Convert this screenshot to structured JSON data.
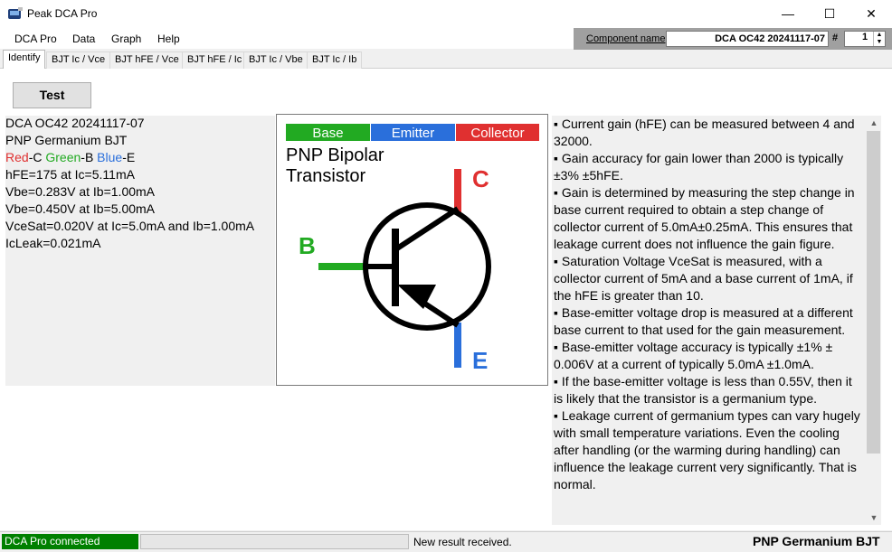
{
  "window": {
    "title": "Peak DCA Pro",
    "minimize": "—",
    "maximize": "☐",
    "close": "✕"
  },
  "menu": [
    "DCA Pro",
    "Data",
    "Graph",
    "Help"
  ],
  "component": {
    "label": "Component name",
    "value": "DCA OC42 20241117-07",
    "number_label": "#",
    "number_value": "1"
  },
  "tabs": [
    "Identify",
    "BJT Ic / Vce",
    "BJT hFE / Vce",
    "BJT hFE / Ic",
    "BJT Ic / Vbe",
    "BJT Ic / Ib"
  ],
  "test_button": "Test",
  "info": {
    "name": "DCA OC42 20241117-07",
    "type": "PNP Germanium BJT",
    "pins": {
      "red": "Red",
      "red_pin": "-C ",
      "green": "Green",
      "green_pin": "-B ",
      "blue": "Blue",
      "blue_pin": "-E"
    },
    "lines": [
      "hFE=175 at Ic=5.11mA",
      "Vbe=0.283V at Ib=1.00mA",
      "Vbe=0.450V at Ib=5.00mA",
      "VceSat=0.020V at Ic=5.0mA and Ib=1.00mA",
      "IcLeak=0.021mA"
    ]
  },
  "diagram": {
    "legend": {
      "base": "Base",
      "emitter": "Emitter",
      "collector": "Collector"
    },
    "title_line1": "PNP Bipolar",
    "title_line2": "Transistor",
    "label_c": "C",
    "label_b": "B",
    "label_e": "E",
    "colors": {
      "base": "#22aa22",
      "emitter": "#2a6fdb",
      "collector": "#e03030"
    }
  },
  "notes": [
    "▪ Current gain (hFE) can be measured between 4 and 32000.",
    "▪ Gain accuracy for gain lower than 2000 is typically ±3% ±5hFE.",
    "▪ Gain is determined by measuring the step change in base current required to obtain a step change of collector current of 5.0mA±0.25mA. This ensures that leakage current does not influence the gain figure.",
    "▪ Saturation Voltage VceSat is measured, with a collector current of 5mA and a base current of 1mA, if the hFE is greater than 10.",
    "▪ Base-emitter voltage drop is measured at a different base current to that used for the gain measurement.",
    "▪ Base-emitter voltage accuracy is typically ±1% ± 0.006V at a current of typically 5.0mA ±1.0mA.",
    "▪ If the base-emitter voltage is less than 0.55V, then it is likely that the transistor is a germanium type.",
    "▪ Leakage current of germanium types can vary hugely with small temperature variations. Even the cooling after handling (or the warming during handling) can influence the leakage current very significantly. That is normal."
  ],
  "status": {
    "connection": "DCA Pro connected",
    "message": "New result received.",
    "component_type": "PNP Germanium BJT"
  }
}
